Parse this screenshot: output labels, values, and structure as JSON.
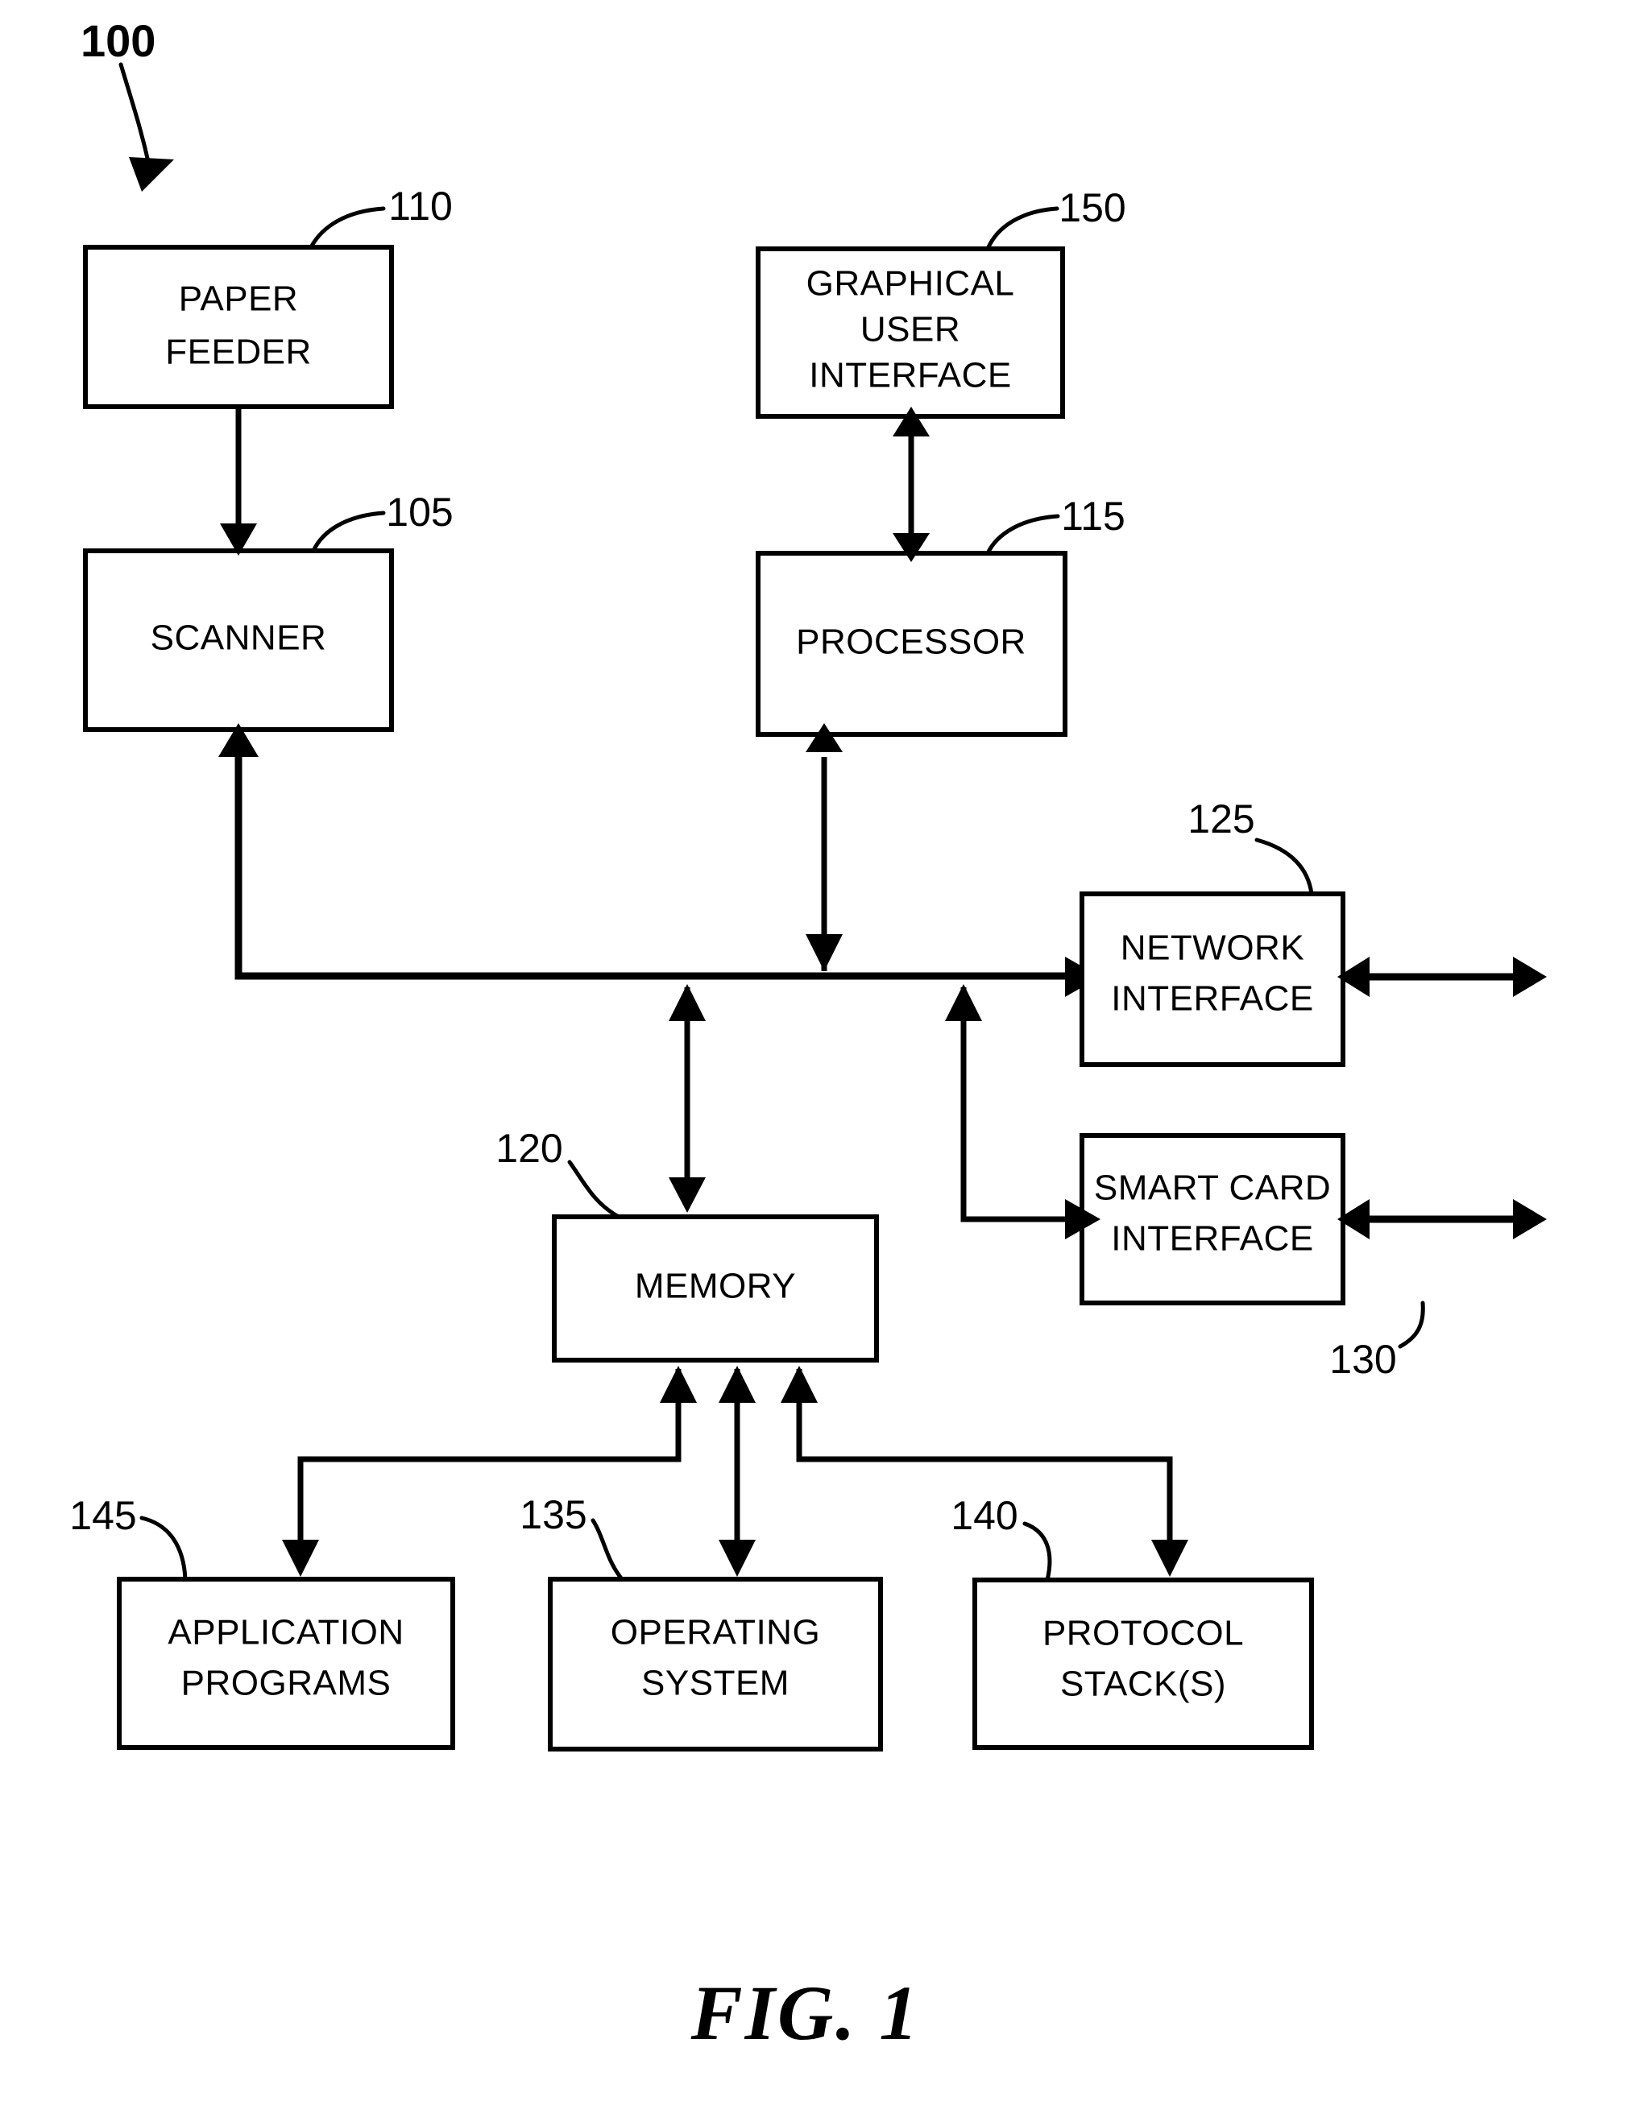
{
  "figure": {
    "caption": "FIG. 1",
    "system_reference": "100"
  },
  "boxes": [
    {
      "id": "paper-feeder",
      "lines": [
        "PAPER",
        "FEEDER"
      ],
      "ref": "110"
    },
    {
      "id": "scanner",
      "lines": [
        "SCANNER"
      ],
      "ref": "105"
    },
    {
      "id": "gui",
      "lines": [
        "GRAPHICAL",
        "USER",
        "INTERFACE"
      ],
      "ref": "150"
    },
    {
      "id": "processor",
      "lines": [
        "PROCESSOR"
      ],
      "ref": "115"
    },
    {
      "id": "network-interface",
      "lines": [
        "NETWORK",
        "INTERFACE"
      ],
      "ref": "125"
    },
    {
      "id": "smart-card-interface",
      "lines": [
        "SMART CARD",
        "INTERFACE"
      ],
      "ref": "130"
    },
    {
      "id": "memory",
      "lines": [
        "MEMORY"
      ],
      "ref": "120"
    },
    {
      "id": "application-programs",
      "lines": [
        "APPLICATION",
        "PROGRAMS"
      ],
      "ref": "145"
    },
    {
      "id": "operating-system",
      "lines": [
        "OPERATING",
        "SYSTEM"
      ],
      "ref": "135"
    },
    {
      "id": "protocol-stacks",
      "lines": [
        "PROTOCOL",
        "STACK(S)"
      ],
      "ref": "140"
    }
  ],
  "colors": {
    "ink": "#000000",
    "paper": "#ffffff"
  }
}
